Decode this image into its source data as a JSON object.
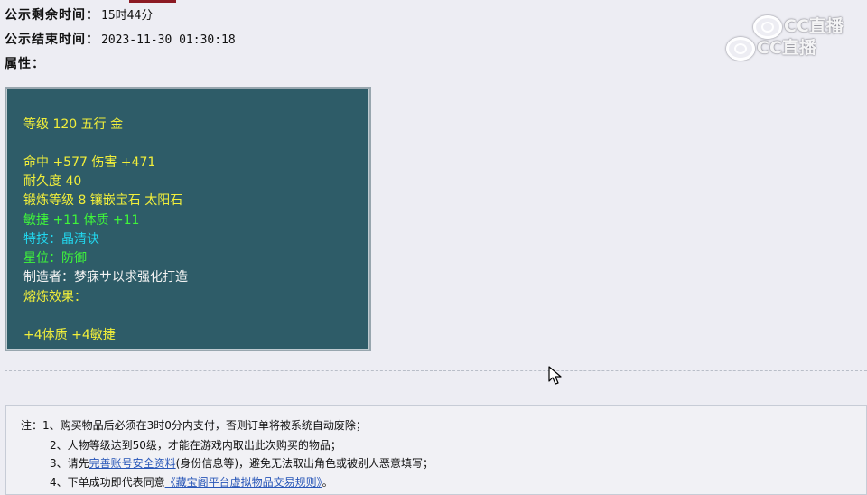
{
  "header": {
    "remaining_label": "公示剩余时间：",
    "remaining_value": "15时44分",
    "end_label": "公示结束时间：",
    "end_value": "2023-11-30 01:30:18",
    "attr_label": "属性："
  },
  "watermark": {
    "line1": "CC直播",
    "line2": "CC直播"
  },
  "attributes": {
    "level_line": "等级 120 五行 金",
    "hit_damage": "命中 +577 伤害 +471",
    "durability": "耐久度 40",
    "forge_gem": "锻炼等级 8 镶嵌宝石 太阳石",
    "agility_con": "敏捷 +11 体质 +11",
    "special_skill": "特技：晶清诀",
    "star_position": "星位：防御",
    "maker": "制造者：梦寐サ以求强化打造",
    "melting_label": "熔炼效果：",
    "melting_value": "+4体质 +4敏捷"
  },
  "colors": {
    "panel_bg": "#2e5c68",
    "yellow_text": "#f2ef3a",
    "green_text": "#3ff53a",
    "cyan_text": "#22d7ee",
    "link_blue": "#2856b8",
    "page_bg": "#ededf3"
  },
  "notes": {
    "prefix": "注：",
    "item1": "1、购买物品后必须在3时0分内支付，否则订单将被系统自动废除；",
    "item2": "2、人物等级达到50级，才能在游戏内取出此次购买的物品；",
    "item3_before": "3、请先",
    "item3_link": "完善账号安全资料",
    "item3_after": "(身份信息等)，避免无法取出角色或被别人恶意填写；",
    "item4_before": "4、下单成功即代表同意",
    "item4_link": "《藏宝阁平台虚拟物品交易规则》",
    "item4_after": "。"
  },
  "icons": {
    "cursor": "mouse-pointer-icon",
    "watermark_logo": "cc-live-logo-icon"
  }
}
